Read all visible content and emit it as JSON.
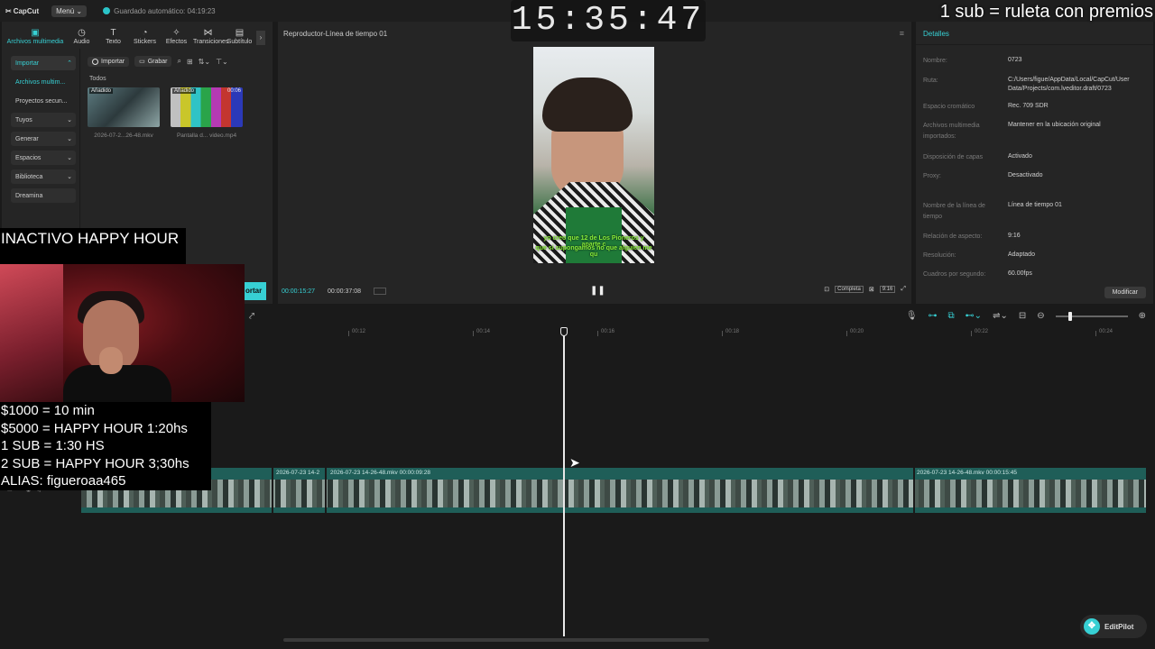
{
  "app": {
    "logo": "CapCut",
    "menu_label": "Menú",
    "autosave": "Guardado automático: 04:19:23"
  },
  "toolbar": {
    "items": [
      {
        "label": "Archivos multimedia",
        "icon": "media-icon"
      },
      {
        "label": "Audio",
        "icon": "audio-icon"
      },
      {
        "label": "Texto",
        "icon": "text-icon"
      },
      {
        "label": "Stickers",
        "icon": "sticker-icon"
      },
      {
        "label": "Efectos",
        "icon": "effects-icon"
      },
      {
        "label": "Transiciones",
        "icon": "transitions-icon"
      },
      {
        "label": "Subtítulo",
        "icon": "subtitle-icon"
      }
    ]
  },
  "sidebar": {
    "items": [
      {
        "label": "Importar"
      },
      {
        "label": "Archivos multim..."
      },
      {
        "label": "Proyectos secun..."
      },
      {
        "label": "Tuyos"
      },
      {
        "label": "Generar"
      },
      {
        "label": "Espacios"
      },
      {
        "label": "Biblioteca"
      },
      {
        "label": "Dreamina"
      }
    ]
  },
  "media": {
    "import_label": "Importar",
    "record_label": "Grabar",
    "filter_label": "Todos",
    "items": [
      {
        "badge": "Añadido",
        "name": "2026-07-2...26-48.mkv",
        "duration": ""
      },
      {
        "badge": "Añadido",
        "name": "Pantalla d... video.mp4",
        "duration": "00:06"
      }
    ]
  },
  "player": {
    "title": "Reproductor-Línea de tiempo 01",
    "current_time": "00:00:15:27",
    "total_time": "00:00:37:08",
    "full_label": "Completa",
    "ratio_label": "9:16",
    "subtitle_line1": "yo creo que 12 de Los Pioneros y aparte c",
    "subtitle_line2": "que si supongamos no que alguien me qu"
  },
  "details": {
    "tab": "Detalles",
    "rows": [
      {
        "key": "Nombre:",
        "value": "0723"
      },
      {
        "key": "Ruta:",
        "value": "C:/Users/figue/AppData/Local/CapCut/User Data/Projects/com.lveditor.draft/0723"
      },
      {
        "key": "Espacio cromático",
        "value": "Rec. 709 SDR"
      },
      {
        "key": "Archivos multimedia importados:",
        "value": "Mantener en la ubicación original"
      },
      {
        "key": "Disposición de capas",
        "value": "Activado"
      },
      {
        "key": "Proxy:",
        "value": "Desactivado"
      },
      {
        "key": "Nombre de la línea de tiempo",
        "value": "Línea de tiempo 01"
      },
      {
        "key": "Relación de aspecto:",
        "value": "9:16"
      },
      {
        "key": "Resolución:",
        "value": "Adaptado"
      },
      {
        "key": "Cuadros por segundo:",
        "value": "60.00fps"
      }
    ],
    "modify_label": "Modificar"
  },
  "overlay": {
    "clock": "15:35:47",
    "promo": "1 sub = ruleta con premios",
    "inactive": "INACTIVO HAPPY HOUR",
    "rules": [
      "$1000 = 10 min",
      "$5000 = HAPPY HOUR 1:20hs",
      "1 SUB = 1:30 HS",
      "2 SUB = HAPPY HOUR 3;30hs",
      "ALIAS: figueroaa465"
    ],
    "cyan_tag": "ortar"
  },
  "timeline": {
    "ticks": [
      "00:12",
      "00:14",
      "00:16",
      "00:18",
      "00:20",
      "00:22",
      "00:24"
    ],
    "clips": [
      {
        "label": "2026-07-23 14-2"
      },
      {
        "label": "2026-07-23 14-26-48.mkv   00:00:09:28"
      },
      {
        "label": "2026-07-23 14-26-48.mkv   00:00:15:45"
      }
    ]
  },
  "editpilot": {
    "label": "EditPilot"
  }
}
